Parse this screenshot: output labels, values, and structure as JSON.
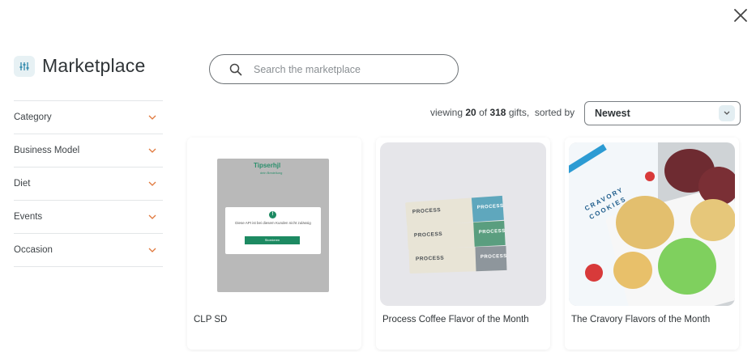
{
  "window": {
    "close_label": "×"
  },
  "brand": {
    "title": "Marketplace",
    "icon": "filter-sliders-icon"
  },
  "search": {
    "placeholder": "Search the marketplace",
    "value": ""
  },
  "filters": [
    {
      "label": "Category"
    },
    {
      "label": "Business Model"
    },
    {
      "label": "Diet"
    },
    {
      "label": "Events"
    },
    {
      "label": "Occasion"
    }
  ],
  "summary": {
    "prefix": "viewing",
    "shown": "20",
    "of": "of",
    "total": "318",
    "suffix": "gifts,  sorted by"
  },
  "sort": {
    "selected": "Newest"
  },
  "cards": [
    {
      "title": "CLP SD",
      "image": {
        "logo_text": "Tipserhjl",
        "sub_text": "dein Bestellung",
        "modal_text": "Diese API ist bei diesem Kunden nicht zulässig",
        "modal_button": "Stornieren"
      }
    },
    {
      "title": "Process Coffee Flavor of the Month",
      "image": {
        "box_label": "PROCESS",
        "box_side_label": "PROCESS"
      }
    },
    {
      "title": "The Cravory Flavors of the Month",
      "image": {
        "brand_text": "CRAVORY COOKIES"
      }
    }
  ],
  "colors": {
    "accent_teal": "#1d8a62",
    "sort_caret_bg": "#e3eef2",
    "box_blue": "#5fa7bd",
    "box_green": "#5a9e7f",
    "box_grey": "#8e969c"
  }
}
